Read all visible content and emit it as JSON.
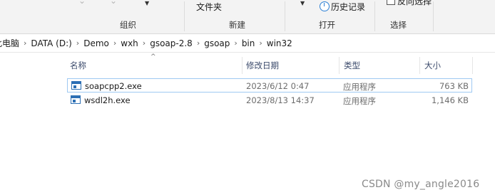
{
  "ribbon": {
    "organize": {
      "label": "组织"
    },
    "new": {
      "label": "新建",
      "new_folder_fragment": "文件夹"
    },
    "open": {
      "label": "打开",
      "history": "历史记录"
    },
    "select": {
      "label": "选择",
      "invert_fragment": "反向选择"
    }
  },
  "address": {
    "crumbs": [
      "此电脑",
      "DATA (D:)",
      "Demo",
      "wxh",
      "gsoap-2.8",
      "gsoap",
      "bin",
      "win32"
    ]
  },
  "columns": {
    "name": "名称",
    "modified": "修改日期",
    "type": "类型",
    "size": "大小"
  },
  "files": [
    {
      "name": "soapcpp2.exe",
      "modified": "2023/6/12 0:47",
      "type": "应用程序",
      "size": "763 KB"
    },
    {
      "name": "wsdl2h.exe",
      "modified": "2023/8/13 14:37",
      "type": "应用程序",
      "size": "1,146 KB"
    }
  ],
  "watermark": "CSDN @my_angle2016"
}
